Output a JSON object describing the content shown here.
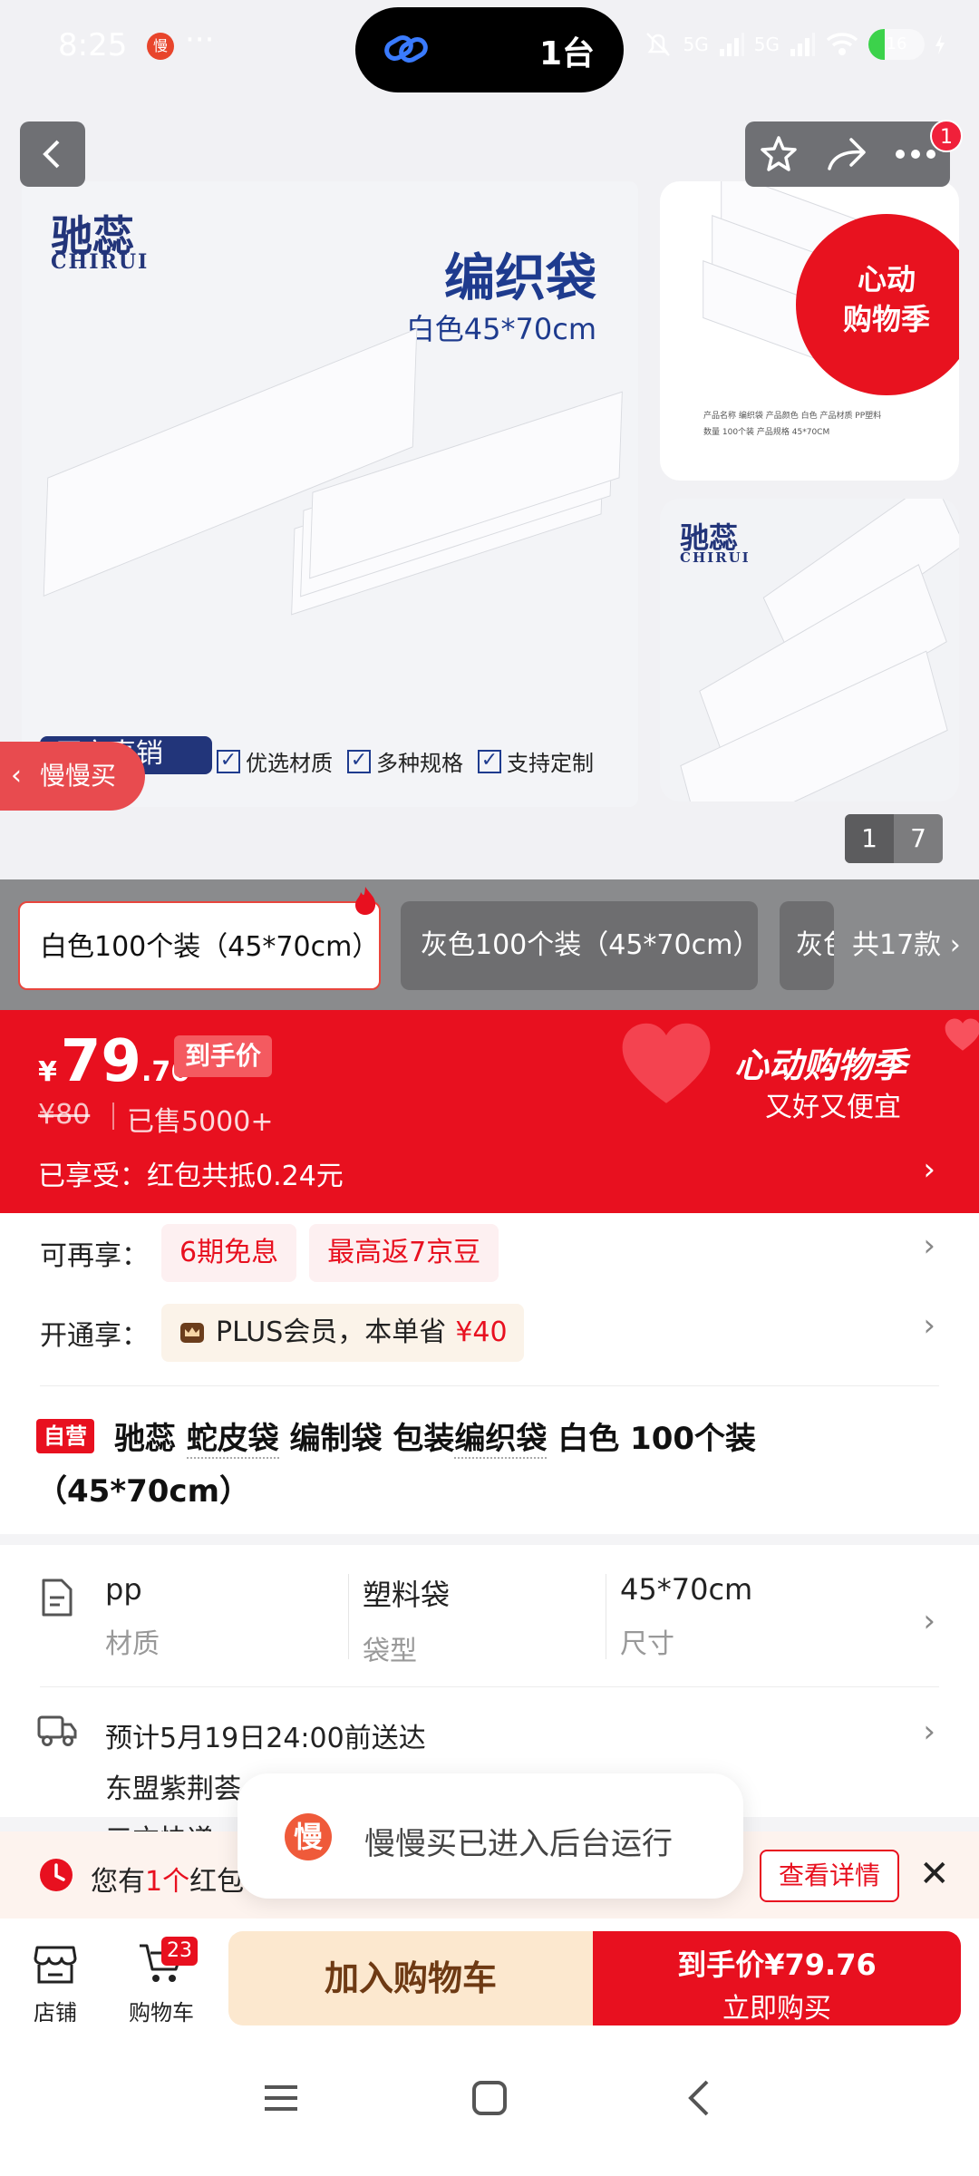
{
  "status_bar": {
    "time": "8:25",
    "app_badge": "慢",
    "more": "···",
    "island_text": "1台",
    "signal_1": "5G",
    "signal_2": "5G",
    "battery": "16"
  },
  "gallery": {
    "brand_cn": "驰蕊",
    "brand_en": "CHIRUI",
    "product_name": "编织袋",
    "product_spec": "白色45*70cm",
    "factory_tag": "厂家直销",
    "features": [
      "优选材质",
      "多种规格",
      "支持定制"
    ],
    "promo_badge": [
      "心动",
      "购物季"
    ],
    "side_table_rows": [
      "产品名称 编织袋    产品颜色 白色    产品材质 PP塑料",
      "数量 100个装    产品规格 45*70CM"
    ],
    "notification_count": "1",
    "slow_buy_label": "慢慢买",
    "slow_buy_chevron": "‹",
    "pager_current": "1",
    "pager_total": "7"
  },
  "variants": {
    "selected": "白色100个装（45*70cm）",
    "second": "灰色100个装（45*70cm）",
    "third": "灰色",
    "count": "共17款 ›"
  },
  "price": {
    "yen": "¥",
    "integer": "79",
    "decimal": ".76",
    "tag": "到手价",
    "original": "¥80",
    "sold": "已售5000+",
    "coupon": "已享受：红包共抵0.24元",
    "chevron": "›",
    "campaign": "心动购物季",
    "campaign_sub": "又好又便宜"
  },
  "benefits": {
    "row1_label": "可再享：",
    "row1_chips": [
      "6期免息",
      "最高返7京豆"
    ],
    "row2_label": "开通享：",
    "plus_text": "PLUS会员，本单省",
    "plus_save": "¥40",
    "chevron": "›"
  },
  "title": {
    "self_tag": "自营",
    "brand": "驰蕊",
    "kw1": "蛇皮袋",
    "mid": "编制袋 包装",
    "kw2": "编织袋",
    "rest": "白色 100个装（45*70cm）"
  },
  "specs": [
    {
      "value": "pp",
      "key": "材质"
    },
    {
      "value": "塑料袋",
      "key": "袋型"
    },
    {
      "value": "45*70cm",
      "key": "尺寸"
    }
  ],
  "shipping": {
    "eta": "预计5月19日24:00前送达",
    "from": "东盟紫荆荟",
    "express": "三方快递",
    "chevron": "›"
  },
  "red_packet": {
    "text_prefix": "您有",
    "count": "1个",
    "text_suffix": "红包",
    "detail_button": "查看详情",
    "close": "✕"
  },
  "toast": {
    "logo": "慢",
    "text": "慢慢买已进入后台运行"
  },
  "bottom_bar": {
    "store": "店铺",
    "cart": "购物车",
    "cart_badge": "23",
    "add_to_cart": "加入购物车",
    "buy_price": "到手价¥79.76",
    "buy_now": "立即购买"
  },
  "colors": {
    "accent_red": "#e8101f",
    "brand_blue": "#23357a"
  }
}
